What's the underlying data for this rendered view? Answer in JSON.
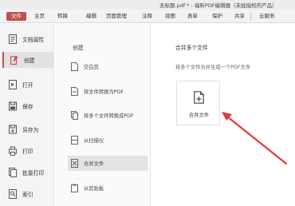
{
  "window": {
    "title": "无标题.pdf * - 福昕PDF编辑器（未经授权的产品）"
  },
  "menu": {
    "items": [
      "文件",
      "主页",
      "转换",
      "编辑",
      "页面管理",
      "注释",
      "视图",
      "表单",
      "保护",
      "共享",
      "云服务"
    ],
    "active_index": 0
  },
  "sidebar": {
    "items": [
      {
        "label": "文档属性",
        "icon": "document-properties-icon"
      },
      {
        "label": "创建",
        "icon": "create-icon"
      },
      {
        "label": "打开",
        "icon": "open-icon"
      },
      {
        "label": "保存",
        "icon": "save-icon"
      },
      {
        "label": "另存为",
        "icon": "save-as-icon"
      },
      {
        "label": "打印",
        "icon": "print-icon"
      },
      {
        "label": "批量打印",
        "icon": "batch-print-icon"
      },
      {
        "label": "索引",
        "icon": "index-icon"
      }
    ],
    "active_index": 1
  },
  "create_panel": {
    "header": "创建",
    "items": [
      {
        "label": "空白页",
        "icon": "blank-page-icon"
      },
      {
        "label": "将文件转换为PDF",
        "icon": "file-to-pdf-icon"
      },
      {
        "label": "将多个文件转换成PDF",
        "icon": "multi-file-to-pdf-icon"
      },
      {
        "label": "从扫描仪",
        "icon": "scanner-icon"
      },
      {
        "label": "合并文件",
        "icon": "merge-files-icon"
      },
      {
        "label": "从剪贴板",
        "icon": "clipboard-icon"
      }
    ],
    "active_index": 4
  },
  "content": {
    "title": "合并多个文件",
    "description": "将多个文件合并生成一个PDF文件",
    "card_label": "合并文件"
  },
  "colors": {
    "accent": "#c0504f",
    "arrow": "#e23b3b"
  }
}
